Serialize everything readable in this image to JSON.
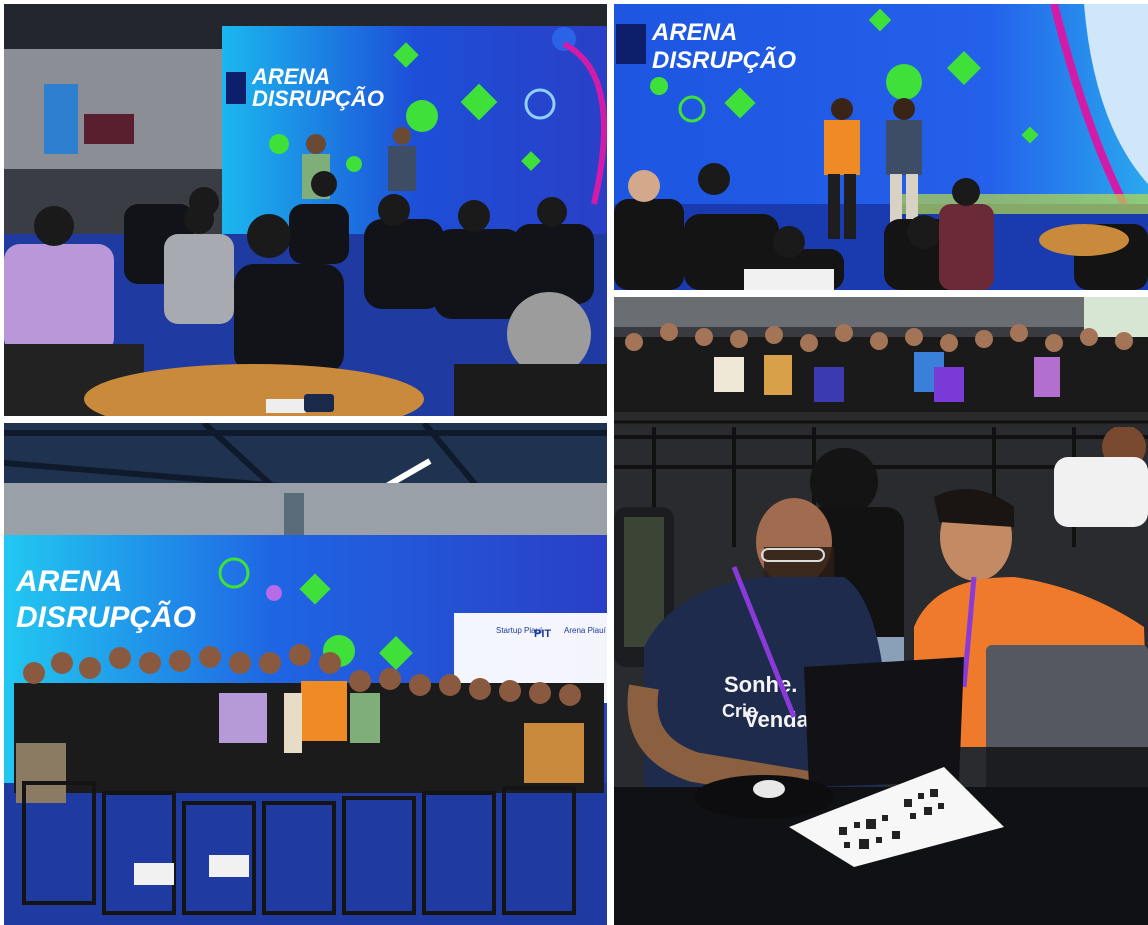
{
  "collage": {
    "photos": [
      {
        "name": "stage-audience-wide"
      },
      {
        "name": "stage-speakers-closeup"
      },
      {
        "name": "group-photo"
      },
      {
        "name": "crowd-seated"
      },
      {
        "name": "laptop-qr-workshop"
      }
    ]
  },
  "signage": {
    "arena_line1": "ARENA",
    "arena_line2": "DISRUPÇÃO",
    "partner_1": "Startup Piauí",
    "partner_2": "PIT",
    "partner_3": "Arena Piauí"
  },
  "shirt_text": {
    "line1": "Sonhe.",
    "line2": "Crie",
    "line3": "Venda."
  },
  "colors": {
    "backdrop_blue": "#1d4fd8",
    "backdrop_cyan": "#22c8f0",
    "accent_green": "#3fe03a",
    "accent_magenta": "#d21ca8",
    "floor_blue": "#1f3aa0",
    "wood_table": "#c98a3c"
  }
}
